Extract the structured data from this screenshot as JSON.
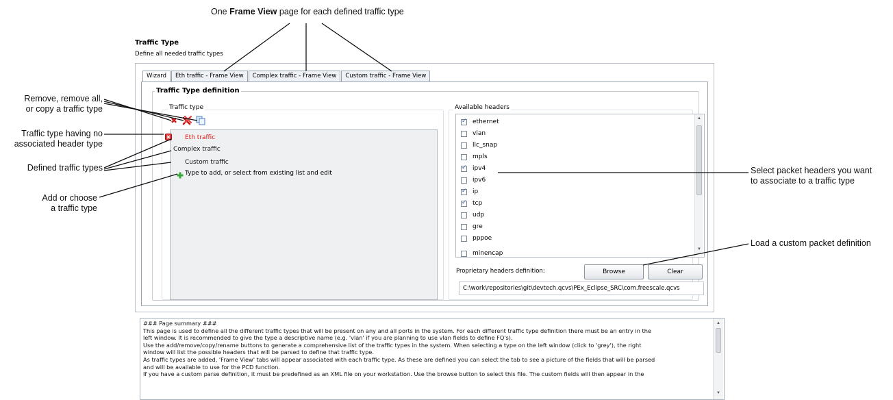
{
  "annotations": {
    "top_prefix": "One",
    "top_bold": "Frame View",
    "top_suffix": "page for each defined traffic type",
    "remove": [
      "Remove, remove all,",
      "or copy a traffic type"
    ],
    "no_header": [
      "Traffic type having no",
      "associated header type"
    ],
    "defined": "Defined traffic types",
    "add": [
      "Add or choose",
      "a traffic type"
    ],
    "select_headers": [
      "Select packet headers you want",
      "to associate to a traffic type"
    ],
    "load_custom": "Load a custom packet definition"
  },
  "page": {
    "title": "Traffic Type",
    "subtitle": "Define all needed traffic types"
  },
  "tabs": [
    {
      "label": "Wizard"
    },
    {
      "label": "Eth traffic - Frame View"
    },
    {
      "label": "Complex traffic - Frame View"
    },
    {
      "label": "Custom traffic - Frame View"
    }
  ],
  "definition": {
    "group_title": "Traffic Type definition",
    "traffic_type_label": "Traffic type",
    "items": [
      {
        "label": "Eth traffic",
        "color": "#e01818"
      },
      {
        "label": "Complex traffic",
        "color": "#111111"
      },
      {
        "label": "Custom traffic",
        "color": "#111111"
      }
    ],
    "add_prompt": "Type to add, or select from existing list and edit"
  },
  "headers": {
    "label": "Available headers",
    "items": [
      {
        "name": "ethernet",
        "checked": true
      },
      {
        "name": "vlan",
        "checked": false
      },
      {
        "name": "llc_snap",
        "checked": false
      },
      {
        "name": "mpls",
        "checked": false
      },
      {
        "name": "ipv4",
        "checked": true
      },
      {
        "name": "ipv6",
        "checked": false
      },
      {
        "name": "ip",
        "checked": true
      },
      {
        "name": "tcp",
        "checked": true
      },
      {
        "name": "udp",
        "checked": false
      },
      {
        "name": "gre",
        "checked": false
      },
      {
        "name": "pppoe",
        "checked": false
      },
      {
        "name": "minencap",
        "checked": false
      }
    ],
    "proprietary_label": "Proprietary headers definition:",
    "browse_label": "Browse",
    "clear_label": "Clear",
    "path": "C:\\work\\repositories\\git\\devtech.qcvs\\PEx_Eclipse_SRC\\com.freescale.qcvs"
  },
  "summary": {
    "lines": [
      "### Page summary ###",
      "This page is used to define all the different traffic types that will be present on any and all ports in the system. For each different traffic type definition there must be an entry in the",
      "left window. It is recommended to give the type a descriptive name (e.g. 'vlan' if you are planning to use vlan fields to define FQ's).",
      "Use the add/remove/copy/rename buttons to generate a comprehensive list of the traffic types in the system. When selecting a type on the left window (click to 'grey'), the right",
      "window will list the possible headers that will be parsed to define that traffic type.",
      "As traffic types are added, 'Frame View' tabs will appear associated with each traffic type. As these are defined you can select the tab to see a picture of the fields that will be parsed",
      "and will be available to use for the PCD function.",
      "If you have a custom parse definition, it must be predefined as an XML file on your workstation. Use the browse button to select this file. The custom fields will then appear in the"
    ]
  }
}
